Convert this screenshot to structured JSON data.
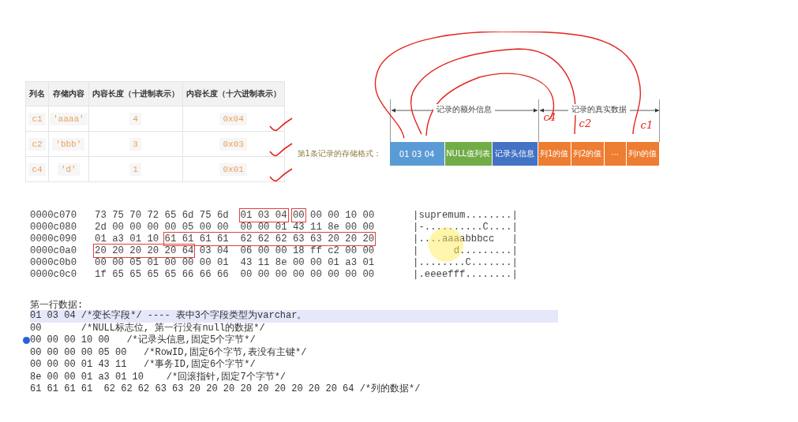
{
  "table": {
    "columns": [
      "列名",
      "存储内容",
      "内容长度（十进制表示）",
      "内容长度（十六进制表示）"
    ],
    "rows": [
      {
        "cells": [
          "c1",
          "'aaaa'",
          "4",
          "0x04"
        ],
        "ticked": true
      },
      {
        "cells": [
          "c2",
          "'bbb'",
          "3",
          "0x03"
        ],
        "ticked": true
      },
      {
        "cells": [
          "c4",
          "'d'",
          "1",
          "0x01"
        ],
        "ticked": true
      }
    ]
  },
  "diagram": {
    "label": "第1条记录的存储格式：",
    "spans": [
      {
        "text": "记录的额外信息"
      },
      {
        "text": "记录的真实数据"
      }
    ],
    "blocks": [
      {
        "text": "01 03 04",
        "color": "#5b9bd5"
      },
      {
        "text": "NULL值列表",
        "color": "#70ad47"
      },
      {
        "text": "记录头信息",
        "color": "#4472c4"
      },
      {
        "text": "列1的值",
        "color": "#ed7d31"
      },
      {
        "text": "列2的值",
        "color": "#ed7d31"
      },
      {
        "text": "···",
        "color": "#ed7d31"
      },
      {
        "text": "列n的值",
        "color": "#ed7d31"
      }
    ],
    "handwriting": [
      "c4",
      "c2",
      "c1"
    ]
  },
  "hexdump": {
    "rows": [
      {
        "address": "0000c070",
        "segments": [
          {
            "text": "73 75 70 72 65 6d 75 6d",
            "boxed": false
          },
          {
            "text": "01 03 04",
            "boxed": true
          },
          {
            "text": "00",
            "boxed": true
          },
          {
            "text": "00 00 10 00",
            "boxed": false
          }
        ],
        "ascii": "|supremum........|"
      },
      {
        "address": "0000c080",
        "segments": [
          {
            "text": "2d 00 00 00 00 05 00 00",
            "boxed": false
          },
          {
            "text": "00 00 01 43 11 8e 00 00",
            "boxed": false
          }
        ],
        "ascii": "|-..........C....|"
      },
      {
        "address": "0000c090",
        "segments": [
          {
            "text": "01 a3 01 10",
            "boxed": false
          },
          {
            "text": "61 61 61 61  62 62 62 63 63 20 20 20",
            "boxed": true
          }
        ],
        "ascii": "|....aaaabbbcc   |"
      },
      {
        "address": "0000c0a0",
        "segments": [
          {
            "text": "20 20 20 20 20 64",
            "boxed": true
          },
          {
            "text": "03 04  06 00 00 18 ff c2 00 00",
            "boxed": false
          }
        ],
        "ascii": "|      d.........|"
      },
      {
        "address": "0000c0b0",
        "segments": [
          {
            "text": "00 00 05 01 00 00 00 01",
            "boxed": false
          },
          {
            "text": "43 11 8e 00 00 01 a3 01",
            "boxed": false
          }
        ],
        "ascii": "|........C.......|"
      },
      {
        "address": "0000c0c0",
        "segments": [
          {
            "text": "1f 65 65 65 65 66 66 66",
            "boxed": false
          },
          {
            "text": "00 00 00 00 00 00 00 00",
            "boxed": false
          }
        ],
        "ascii": "|.eeeefff........|"
      }
    ]
  },
  "notes": {
    "title": "第一行数据:",
    "lines": [
      {
        "text": "01 03 04 /*变长字段*/ ---- 表中3个字段类型为varchar。",
        "highlighted": true,
        "marker": false
      },
      {
        "text": "00       /*NULL标志位, 第一行没有null的数据*/",
        "highlighted": false,
        "marker": false
      },
      {
        "text": "00 00 00 10 00   /*记录头信息,固定5个字节*/",
        "highlighted": false,
        "marker": true
      },
      {
        "text": "00 00 00 00 05 00   /*RowID,固定6个字节,表没有主键*/",
        "highlighted": false,
        "marker": false
      },
      {
        "text": "00 00 00 01 43 11   /*事务ID,固定6个字节*/",
        "highlighted": false,
        "marker": false
      },
      {
        "text": "8e 00 00 01 a3 01 10    /*回滚指针,固定7个字节*/",
        "highlighted": false,
        "marker": false
      },
      {
        "text": "61 61 61 61  62 62 62 63 63 20 20 20 20 20 20 20 20 20 64 /*列的数据*/",
        "highlighted": false,
        "marker": false
      }
    ]
  }
}
